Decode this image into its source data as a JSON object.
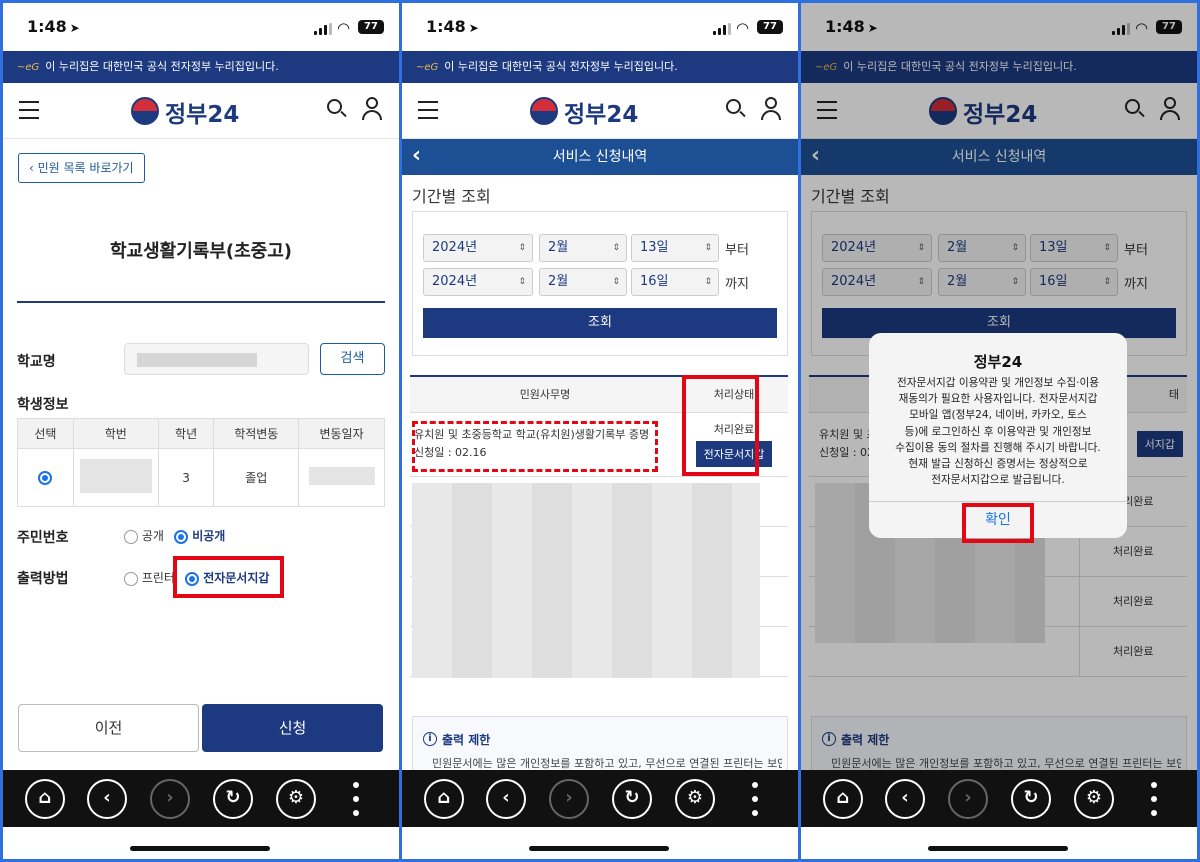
{
  "status": {
    "time": "1:48",
    "battery": "77"
  },
  "gov_banner": "이 누리집은 대한민국 공식 전자정부 누리집입니다.",
  "header": {
    "logo_text": "정부24"
  },
  "icons": {
    "menu": "menu-icon",
    "search": "search-icon",
    "user": "user-icon",
    "home": "home-icon",
    "back": "chevron-left-icon",
    "forward": "chevron-right-icon",
    "refresh": "refresh-icon",
    "settings": "gear-icon",
    "more": "more-icon"
  },
  "colors": {
    "navy": "#1d3a80",
    "highlight": "#e30613",
    "accent": "#1a73e8"
  },
  "screen1": {
    "back_link": "민원 목록 바로가기",
    "title": "학교생활기록부(초중고)",
    "school_label": "학교명",
    "search_label": "검색",
    "student_label": "학생정보",
    "table_headers": [
      "선택",
      "학번",
      "학년",
      "학적변동",
      "변동일자"
    ],
    "row": {
      "grade": "3",
      "status": "졸업"
    },
    "resident_label": "주민번호",
    "resident_options": [
      "공개",
      "비공개"
    ],
    "output_label": "출력방법",
    "output_options": [
      "프린터",
      "전자문서지갑"
    ],
    "prev": "이전",
    "apply": "신청"
  },
  "screen2": {
    "subhead": "서비스 신청내역",
    "section": "기간별 조회",
    "from": {
      "year": "2024년",
      "month": "2월",
      "day": "13일",
      "suffix": "부터"
    },
    "to": {
      "year": "2024년",
      "month": "2월",
      "day": "16일",
      "suffix": "까지"
    },
    "query": "조회",
    "col_name": "민원사무명",
    "col_status": "처리상태",
    "item_name": "유치원 및 초중등학교 학교(유치원)생활기록부 증명",
    "item_date": "신청일 : 02.16",
    "item_status": "처리완료",
    "wallet_btn": "전자문서지갑",
    "notice_title": "출력 제한",
    "notice_text": "민원문서에는 많은 개인정보를 포함하고 있고, 무선으로 연결된 프린터는 보안"
  },
  "screen3": {
    "row_trunc": "유치원 및 초",
    "status_trunc": "태",
    "wallet_trunc": "서지갑",
    "rows_status": [
      "처리완료",
      "처리완료",
      "처리완료",
      "처리완료"
    ],
    "dialog": {
      "title": "정부24",
      "lines": [
        "전자문서지갑 이용약관 및 개인정보 수집·이용",
        "재동의가 필요한 사용자입니다. 전자문서지갑",
        "모바일 앱(정부24, 네이버, 카카오, 토스",
        "등)에 로그인하신 후 이용약관 및 개인정보",
        "수집이용 동의 절차를 진행해 주시기 바랍니다.",
        "현재 발급 신청하신 증명서는 정상적으로",
        "전자문서지갑으로 발급됩니다."
      ],
      "ok": "확인"
    }
  }
}
